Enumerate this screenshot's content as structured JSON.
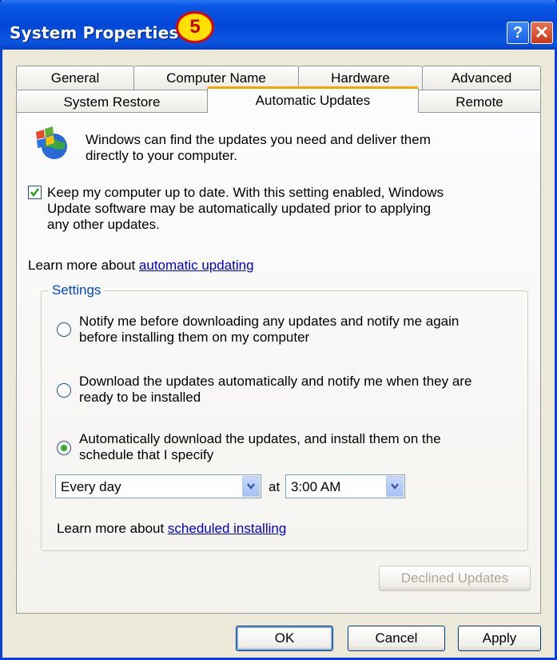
{
  "window": {
    "title": "System Properties",
    "step_badge": "5",
    "help_label": "?",
    "close_label": "✕"
  },
  "tabs": {
    "row1": [
      "General",
      "Computer Name",
      "Hardware",
      "Advanced"
    ],
    "row2": [
      "System Restore",
      "Automatic Updates",
      "Remote"
    ],
    "active": "Automatic Updates"
  },
  "panel": {
    "intro_line1": "Windows can find the updates you need and deliver them",
    "intro_line2": "directly to your computer.",
    "keep_uptodate_checked": true,
    "keep_line1": "Keep my computer up to date. With this setting enabled, Windows",
    "keep_line2": "Update software may be automatically updated prior to applying",
    "keep_line3": "any other updates.",
    "learn_more_prefix": "Learn more about ",
    "learn_more_link": "automatic updating",
    "settings_label": "Settings",
    "option1_line1": "Notify me before downloading any updates and notify me again",
    "option1_line2": "before installing them on my computer",
    "option2_line1": "Download the updates automatically and notify me when they are",
    "option2_line2": "ready to be installed",
    "option3_line1": "Automatically download the updates, and install them on the",
    "option3_line2": "schedule that I specify",
    "selected_option": 3,
    "day_select": "Every day",
    "at_label": "at",
    "time_select": "3:00 AM",
    "learn_sched_prefix": "Learn more about ",
    "learn_sched_link": "scheduled installing",
    "declined_button": "Declined Updates"
  },
  "buttons": {
    "ok": "OK",
    "cancel": "Cancel",
    "apply": "Apply"
  },
  "colors": {
    "titlebar": "#0347d8",
    "window_bg": "#ece9d8",
    "active_tab_accent": "#f7a600",
    "link": "#0000d0",
    "group_label": "#0046d5"
  }
}
